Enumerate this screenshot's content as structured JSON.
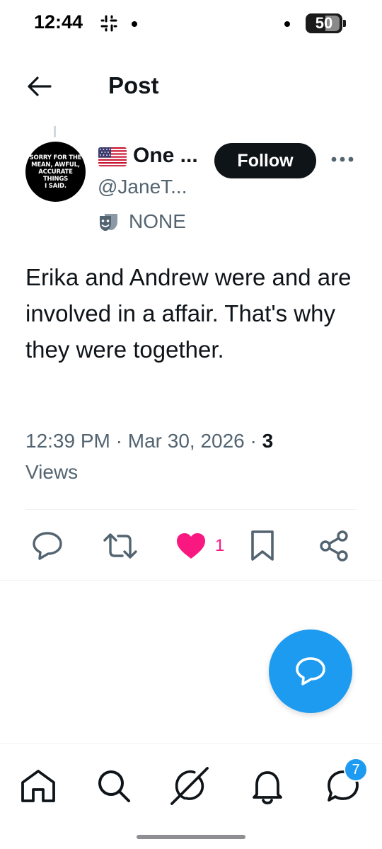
{
  "status_bar": {
    "time": "12:44",
    "battery": "50"
  },
  "header": {
    "title": "Post"
  },
  "author": {
    "display_name": "One ...",
    "handle": "@JaneT...",
    "label": "NONE",
    "avatar_text": [
      "SORRY FOR THE",
      "MEAN, AWFUL,",
      "ACCURATE THINGS",
      "I SAID."
    ],
    "follow_label": "Follow"
  },
  "post": {
    "text": "Erika and Andrew were and are involved in a affair. That's why they were together.",
    "time": "12:39 PM",
    "separator": "·",
    "date": "Mar 30, 2026",
    "views_count": "3",
    "views_label": "Views"
  },
  "actions": {
    "like_count": "1"
  },
  "nav": {
    "messages_badge": "7"
  },
  "colors": {
    "accent": "#1d9bf0",
    "like": "#f91880",
    "text_primary": "#0f1419",
    "text_secondary": "#536471"
  },
  "icons": [
    "slack-icon",
    "back-arrow-icon",
    "us-flag-icon",
    "masks-icon",
    "more-icon",
    "reply-icon",
    "repost-icon",
    "heart-icon",
    "bookmark-icon",
    "share-icon",
    "compose-reply-icon",
    "home-icon",
    "search-icon",
    "grok-icon",
    "bell-icon",
    "messages-icon"
  ]
}
